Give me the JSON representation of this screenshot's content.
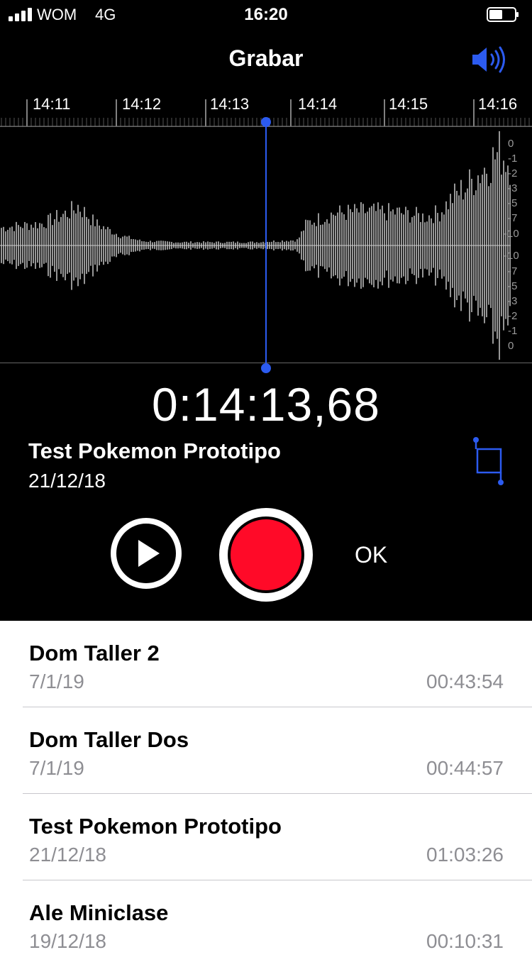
{
  "status_bar": {
    "carrier": "WOM",
    "network": "4G",
    "time": "16:20"
  },
  "header": {
    "title": "Grabar",
    "speaker_icon": "speaker-volume-icon"
  },
  "timeline": {
    "ticks": [
      "14:11",
      "14:12",
      "14:13",
      "14:14",
      "14:15",
      "14:16"
    ]
  },
  "db_scale": {
    "labels": [
      "0",
      "-1",
      "-2",
      "-3",
      "-5",
      "-7",
      "-10",
      "-10",
      "-7",
      "-5",
      "-3",
      "-2",
      "-1",
      "0"
    ]
  },
  "recording": {
    "elapsed": "0:14:13,68",
    "title": "Test Pokemon Prototipo",
    "date": "21/12/18"
  },
  "controls": {
    "done_label": "OK",
    "play_icon": "play-icon",
    "record_icon": "record-icon",
    "trim_icon": "trim-icon"
  },
  "colors": {
    "accent": "#2c5bf0",
    "record": "#ff0a28"
  },
  "recordings": [
    {
      "name": "Dom Taller 2",
      "date": "7/1/19",
      "duration": "00:43:54"
    },
    {
      "name": "Dom Taller Dos",
      "date": "7/1/19",
      "duration": "00:44:57"
    },
    {
      "name": "Test Pokemon Prototipo",
      "date": "21/12/18",
      "duration": "01:03:26"
    },
    {
      "name": "Ale Miniclase",
      "date": "19/12/18",
      "duration": "00:10:31"
    }
  ]
}
